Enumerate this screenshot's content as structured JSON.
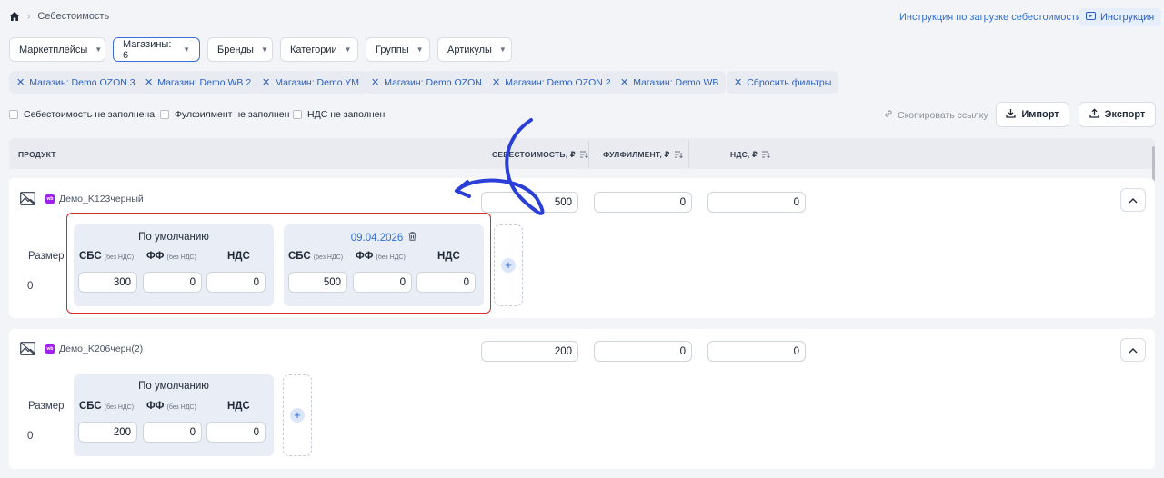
{
  "breadcrumb": {
    "current": "Себестоимость"
  },
  "header": {
    "instruction_link": "Инструкция по загрузке себестоимости",
    "instruction_button": "Инструкция"
  },
  "filters": [
    {
      "label": "Маркетплейсы"
    },
    {
      "label": "Магазины: 6"
    },
    {
      "label": "Бренды"
    },
    {
      "label": "Категории"
    },
    {
      "label": "Группы"
    },
    {
      "label": "Артикулы"
    }
  ],
  "chips": [
    "Магазин: Demo OZON 3",
    "Магазин: Demo WB 2",
    "Магазин: Demo YM",
    "Магазин: Demo OZON",
    "Магазин: Demo OZON 2",
    "Магазин: Demo WB",
    "Сбросить фильтры"
  ],
  "checks": [
    "Себестоимость не заполнена",
    "Фулфилмент не заполнен",
    "НДС не заполнен"
  ],
  "actions": {
    "copy_link": "Скопировать ссылку",
    "import": "Импорт",
    "export": "Экспорт"
  },
  "table": {
    "col_product": "ПРОДУКТ",
    "col_cost": "СЕБЕСТОИМОСТЬ, ₽",
    "col_ff": "ФУЛФИЛМЕНТ, ₽",
    "col_vat": "НДС, ₽"
  },
  "labels": {
    "size": "Размер",
    "default_title": "По умолчанию",
    "sbs": "СБС",
    "ff": "ФФ",
    "vat": "НДС",
    "no_vat": "(без НДС)",
    "wb_badge": "wb"
  },
  "products": [
    {
      "name": "Демо_K123черный",
      "cost": "500",
      "ff": "0",
      "vat": "0",
      "size_value": "0",
      "default": {
        "sbs": "300",
        "ff": "0",
        "vat": "0"
      },
      "dated": {
        "date": "09.04.2026",
        "sbs": "500",
        "ff": "0",
        "vat": "0"
      }
    },
    {
      "name": "Демо_K206черн(2)",
      "cost": "200",
      "ff": "0",
      "vat": "0",
      "size_value": "0",
      "default": {
        "sbs": "200",
        "ff": "0",
        "vat": "0"
      }
    }
  ],
  "colors": {
    "accent": "#2f6fd6",
    "highlight_frame": "#d92b2b",
    "annotation_arrow": "#2a3fd8"
  }
}
